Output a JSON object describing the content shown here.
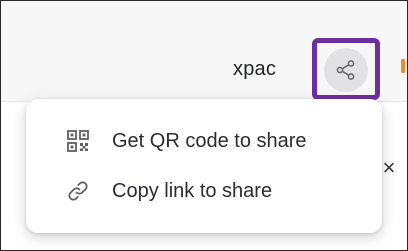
{
  "header": {
    "project_name": "xpac"
  },
  "share_menu": {
    "items": [
      {
        "label": "Get QR code to share",
        "icon": "qr-code-icon"
      },
      {
        "label": "Copy link to share",
        "icon": "link-icon"
      }
    ]
  },
  "dialog": {
    "close_label": "×"
  },
  "colors": {
    "highlight": "#6b2fa0",
    "share_button_bg": "#e2e2e4",
    "accent_orange": "#f08a24"
  }
}
